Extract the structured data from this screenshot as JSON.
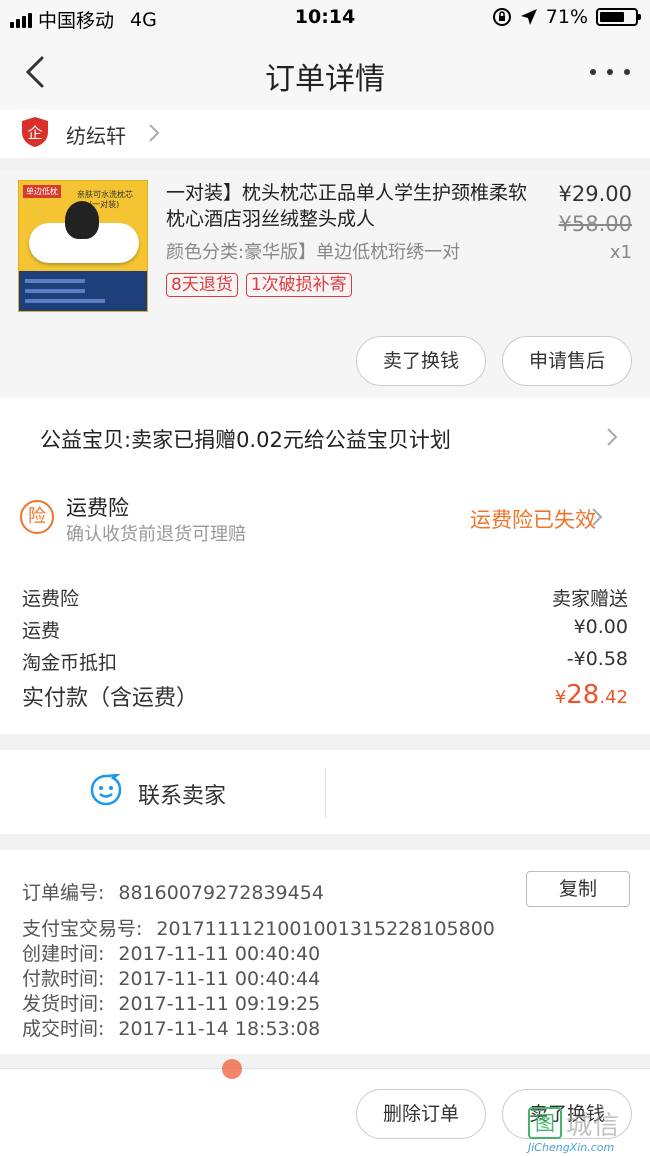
{
  "status_bar": {
    "carrier": "中国移动",
    "network": "4G",
    "time": "10:14",
    "battery": "71%",
    "battery_level": 0.71
  },
  "nav": {
    "title": "订单详情",
    "back_icon": "chevron-left-icon",
    "more_icon": "more-dots-icon"
  },
  "shop": {
    "name": "纺纭轩",
    "badge_text": "企",
    "badge_color": "#d9302a"
  },
  "item": {
    "title": "一对装】枕头枕芯正品单人学生护颈椎柔软枕心酒店羽丝绒整头成人",
    "spec": "颜色分类:豪华版】单边低枕珩绣一对",
    "price": "¥29.00",
    "original_price": "¥58.00",
    "quantity": "x1",
    "tags": [
      "8天退货",
      "1次破损补寄"
    ],
    "thumb": {
      "label": "单边低枕",
      "subtitle": "亲肤可水洗枕芯",
      "badge": "(一对装)"
    },
    "buttons": {
      "sell": "卖了换钱",
      "after_sale": "申请售后"
    }
  },
  "charity": {
    "text": "公益宝贝:卖家已捐赠0.02元给公益宝贝计划"
  },
  "insurance": {
    "icon_text": "险",
    "title": "运费险",
    "desc": "确认收货前退货可理赔",
    "status": "运费险已失效",
    "accent": "#f0742a"
  },
  "costs": {
    "rows": [
      {
        "label": "运费险",
        "value": "卖家赠送"
      },
      {
        "label": "运费",
        "value": "¥0.00"
      },
      {
        "label": "淘金币抵扣",
        "value": "-¥0.58"
      }
    ],
    "total": {
      "label": "实付款（含运费）",
      "currency": "¥",
      "integer": "28",
      "decimal": ".42"
    }
  },
  "contact": {
    "label": "联系卖家",
    "icon": "chat-face-icon"
  },
  "order_info": {
    "order_no_label": "订单编号:",
    "order_no": "88160079272839454",
    "copy_label": "复制",
    "alipay_label": "支付宝交易号:",
    "alipay_no": "2017111121001001315228105800",
    "created_label": "创建时间:",
    "created": "2017-11-11 00:40:40",
    "paid_label": "付款时间:",
    "paid": "2017-11-11 00:40:44",
    "shipped_label": "发货时间:",
    "shipped": "2017-11-11 09:19:25",
    "completed_label": "成交时间:",
    "completed": "2017-11-14 18:53:08"
  },
  "footer": {
    "delete": "删除订单",
    "sell": "卖了换钱"
  },
  "watermark": {
    "icon": "图",
    "text": "城信",
    "url": "JiChengXin.com"
  }
}
